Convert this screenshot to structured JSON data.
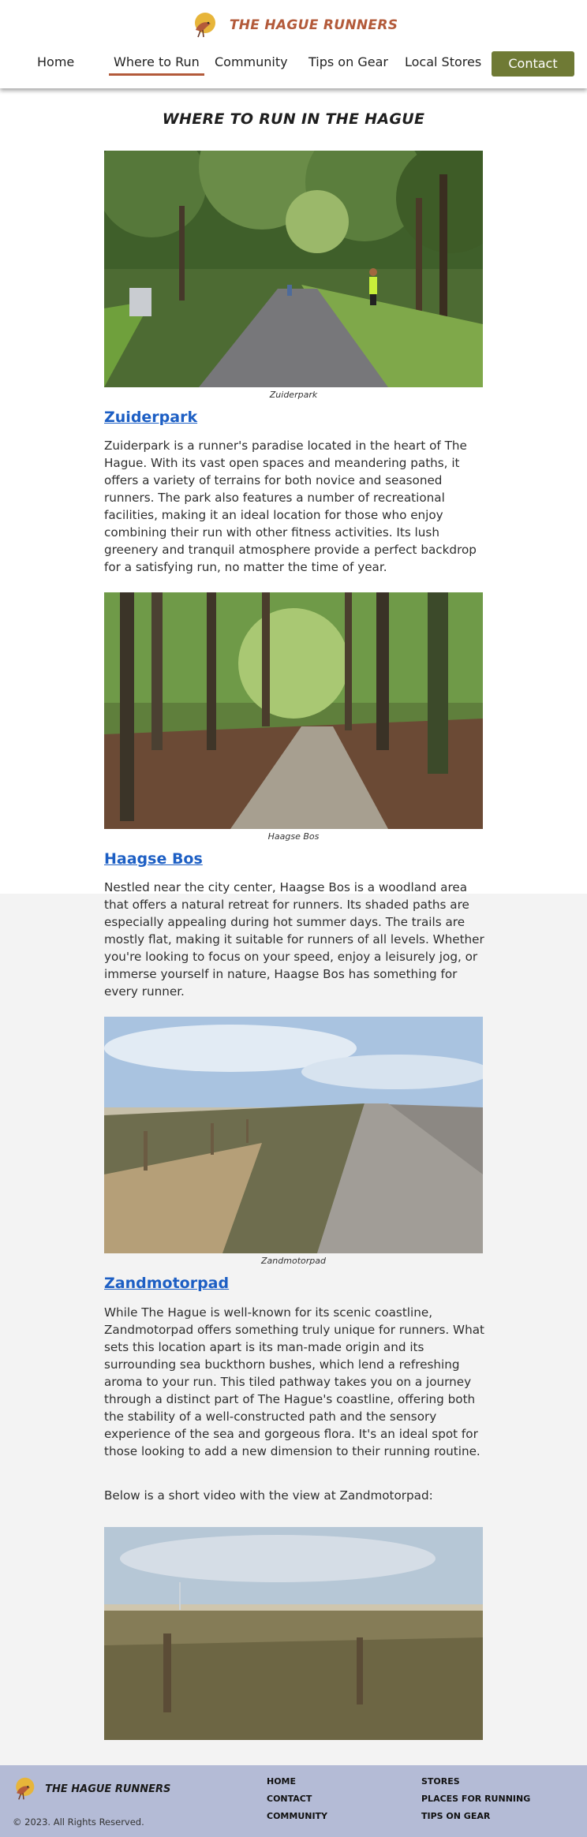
{
  "brand": {
    "name": "THE HAGUE RUNNERS",
    "logo_icon": "runner-bird-logo-icon"
  },
  "nav": {
    "items": [
      {
        "label": "Home"
      },
      {
        "label": "Where to Run",
        "active": true
      },
      {
        "label": "Community"
      },
      {
        "label": "Tips on Gear"
      },
      {
        "label": "Local Stores"
      }
    ],
    "contact_label": "Contact"
  },
  "page": {
    "title": "WHERE TO RUN IN THE HAGUE",
    "places": [
      {
        "caption": "Zuiderpark",
        "title": "Zuiderpark",
        "description": "Zuiderpark is a runner's paradise located in the heart of The Hague. With its vast open spaces and meandering paths, it offers a variety of terrains for both novice and seasoned runners. The park also features a number of recreational facilities, making it an ideal location for those who enjoy combining their run with other fitness activities. Its lush greenery and tranquil atmosphere provide a perfect backdrop for a satisfying run, no matter the time of year."
      },
      {
        "caption": "Haagse Bos",
        "title": "Haagse Bos",
        "description": "Nestled near the city center, Haagse Bos is a woodland area that offers a natural retreat for runners. Its shaded paths are especially appealing during hot summer days. The trails are mostly flat, making it suitable for runners of all levels. Whether you're looking to focus on your speed, enjoy a leisurely jog, or immerse yourself in nature, Haagse Bos has something for every runner."
      },
      {
        "caption": "Zandmotorpad",
        "title": "Zandmotorpad",
        "description": "While The Hague is well-known for its scenic coastline, Zandmotorpad offers something truly unique for runners. What sets this location apart is its man-made origin and its surrounding sea buckthorn bushes, which lend a refreshing aroma to your run. This tiled pathway takes you on a journey through a distinct part of The Hague's coastline, offering both the stability of a well-constructed path and the sensory experience of the sea and gorgeous flora. It's an ideal spot for those looking to add a new dimension to their running routine."
      }
    ],
    "video_intro": "Below is a short video with the view at Zandmotorpad:"
  },
  "footer": {
    "brand": "THE HAGUE RUNNERS",
    "copyright": "© 2023. All Rights Reserved.",
    "links_col1": [
      "HOME",
      "CONTACT",
      "COMMUNITY"
    ],
    "links_col2": [
      "STORES",
      "PLACES FOR RUNNING",
      "TIPS ON GEAR"
    ]
  },
  "colors": {
    "accent": "#b35a3a",
    "contact_button": "#6f7a35",
    "footer_bg": "#b4bbd6",
    "link": "#1d5fc4"
  }
}
